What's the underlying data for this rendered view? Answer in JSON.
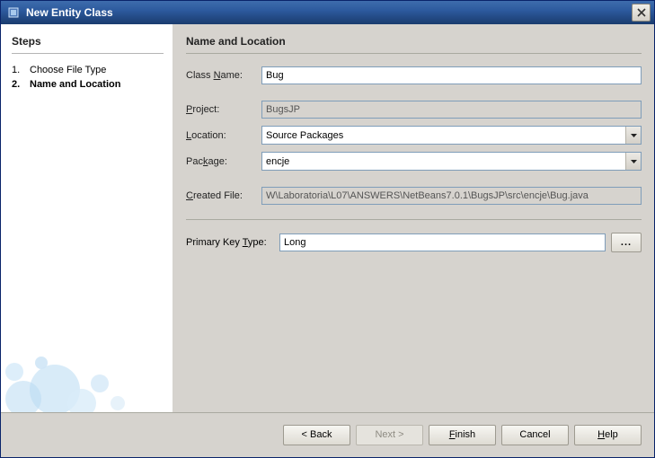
{
  "title": "New Entity Class",
  "side": {
    "header": "Steps",
    "steps": [
      {
        "num": "1.",
        "label": "Choose File Type",
        "current": false
      },
      {
        "num": "2.",
        "label": "Name and Location",
        "current": true
      }
    ]
  },
  "main": {
    "header": "Name and Location",
    "className": {
      "label": "Class Name:",
      "value": "Bug"
    },
    "project": {
      "label": "Project:",
      "value": "BugsJP"
    },
    "location": {
      "label": "Location:",
      "value": "Source Packages"
    },
    "package": {
      "label": "Package:",
      "value": "encje"
    },
    "createdFile": {
      "label": "Created File:",
      "value": "W\\Laboratoria\\L07\\ANSWERS\\NetBeans7.0.1\\BugsJP\\src\\encje\\Bug.java"
    },
    "primaryKeyType": {
      "label": "Primary Key Type:",
      "value": "Long",
      "browse": "..."
    }
  },
  "buttons": {
    "back": "< Back",
    "next": "Next >",
    "finish": "Finish",
    "cancel": "Cancel",
    "help": "Help"
  }
}
